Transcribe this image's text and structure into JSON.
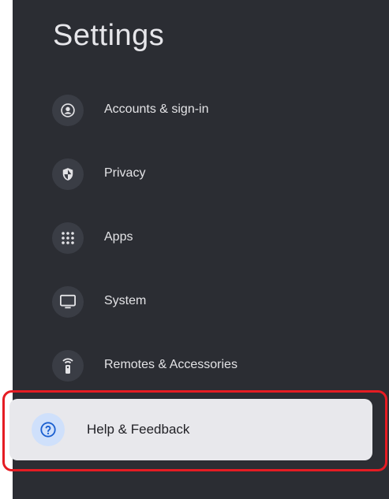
{
  "title": "Settings",
  "items": [
    {
      "label": "Accounts & sign-in",
      "icon": "account-circle-icon"
    },
    {
      "label": "Privacy",
      "icon": "shield-icon"
    },
    {
      "label": "Apps",
      "icon": "apps-grid-icon"
    },
    {
      "label": "System",
      "icon": "monitor-icon"
    },
    {
      "label": "Remotes & Accessories",
      "icon": "remote-icon"
    }
  ],
  "selected": {
    "label": "Help & Feedback",
    "icon": "help-question-icon"
  },
  "colors": {
    "panel": "#2b2d33",
    "icon_bg": "#3a3d45",
    "selected_bg": "#e8e8ec",
    "selected_icon_bg": "#cfe0fb",
    "highlight_outline": "#e51c23"
  }
}
